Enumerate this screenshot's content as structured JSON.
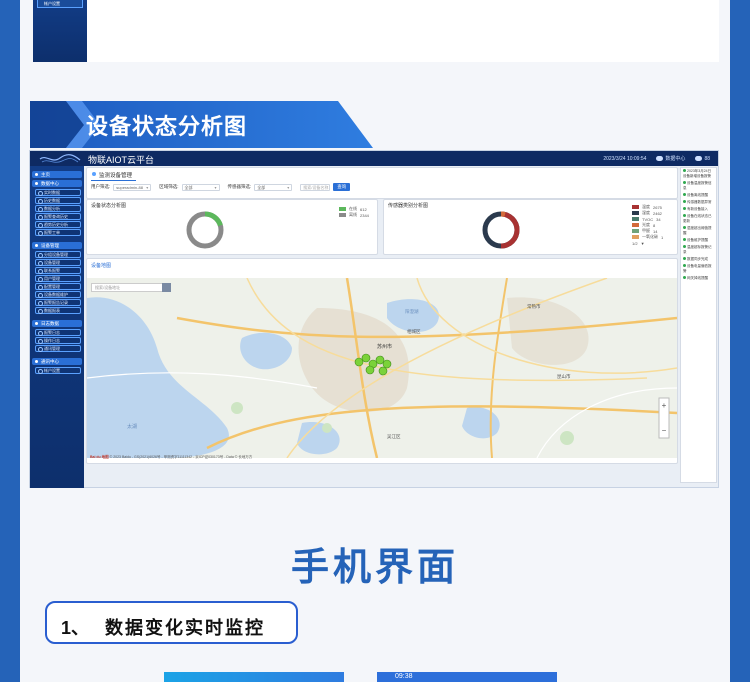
{
  "top": {
    "menu_item": "帐户设置"
  },
  "banner": {
    "title": "设备状态分析图"
  },
  "app": {
    "title": "物联AIOT云平台",
    "datetime": "2023/3/24 10:09:54",
    "header_link": "数据中心",
    "user": "88",
    "sidebar": {
      "groups": [
        {
          "label": "主页",
          "items": []
        },
        {
          "label": "数据中心",
          "items": [
            "实时数据",
            "历史数据",
            "数据分析",
            "报警查询历史",
            "趋势历史分析",
            "报警工单"
          ]
        },
        {
          "label": "设备管理",
          "items": [
            "分组设备管理",
            "设备管理",
            "联系报警",
            "用户管理",
            "配置管理",
            "设备数据维护",
            "报警报告记录",
            "数据报表"
          ]
        },
        {
          "label": "日志数据",
          "items": [
            "报警日志",
            "操作日志",
            "通讯管理"
          ]
        },
        {
          "label": "通讯中心",
          "items": [
            "帐户设置"
          ]
        }
      ]
    },
    "tab": "监测设备管理",
    "filters": {
      "user_label": "用户筛选:",
      "user_value": "superadmin-88",
      "area_label": "区域筛选:",
      "area_value": "全部",
      "sensor_label": "传感器筛选:",
      "sensor_value": "全部",
      "search_placeholder": "搜索/设备名称",
      "query_button": "查询"
    },
    "panels": {
      "status_title": "设备状态分析图",
      "status_legend": [
        {
          "label": "在线",
          "value": "612",
          "color": "#5cb85c"
        },
        {
          "label": "离线",
          "value": "2344",
          "color": "#8a8a8a"
        }
      ],
      "type_title": "传感器类别分析图",
      "type_legend": [
        {
          "label": "温度",
          "value": "2675",
          "color": "#a83232"
        },
        {
          "label": "湿度",
          "value": "2462",
          "color": "#2b3a4d"
        },
        {
          "label": "TVOC",
          "value": "34",
          "color": "#4a7b6c"
        },
        {
          "label": "光度",
          "value": "8",
          "color": "#d36a3a"
        },
        {
          "label": "甲醛",
          "value": "14",
          "color": "#6fa37a"
        },
        {
          "label": "一氧化碳",
          "value": "1",
          "color": "#e0a060"
        }
      ],
      "type_pager": "1/2"
    },
    "map": {
      "label": "设备地图",
      "search_placeholder": "搜索/设备地址",
      "attribution": "© 2023 Baidu - GS(2021)6026号 - 甲测资字11111342 - 京ICP证030173号 - Data © 长地万方",
      "city_label": "苏州市",
      "logo": "Bai du 地图",
      "places": [
        {
          "name": "常熟市"
        },
        {
          "name": "昆山市"
        },
        {
          "name": "吴江区"
        },
        {
          "name": "太湖"
        },
        {
          "name": "阳澄湖"
        },
        {
          "name": "相城区"
        }
      ]
    },
    "notices": [
      "2023年3月24日设备新增设备报警",
      "设备温度报警信息",
      "设备离线提醒",
      "传感器数据异常",
      "有新设备接入",
      "设备在线状态已更新",
      "湿度超出阈值提醒",
      "设备维护提醒",
      "温度超标报警记录",
      "数据同步完成",
      "设备电量偏低报警",
      "网关掉线提醒"
    ]
  },
  "section": {
    "phone_title": "手机界面",
    "num": "1、",
    "text": "数据变化实时监控"
  },
  "phones": {
    "b_time": "09:38"
  }
}
